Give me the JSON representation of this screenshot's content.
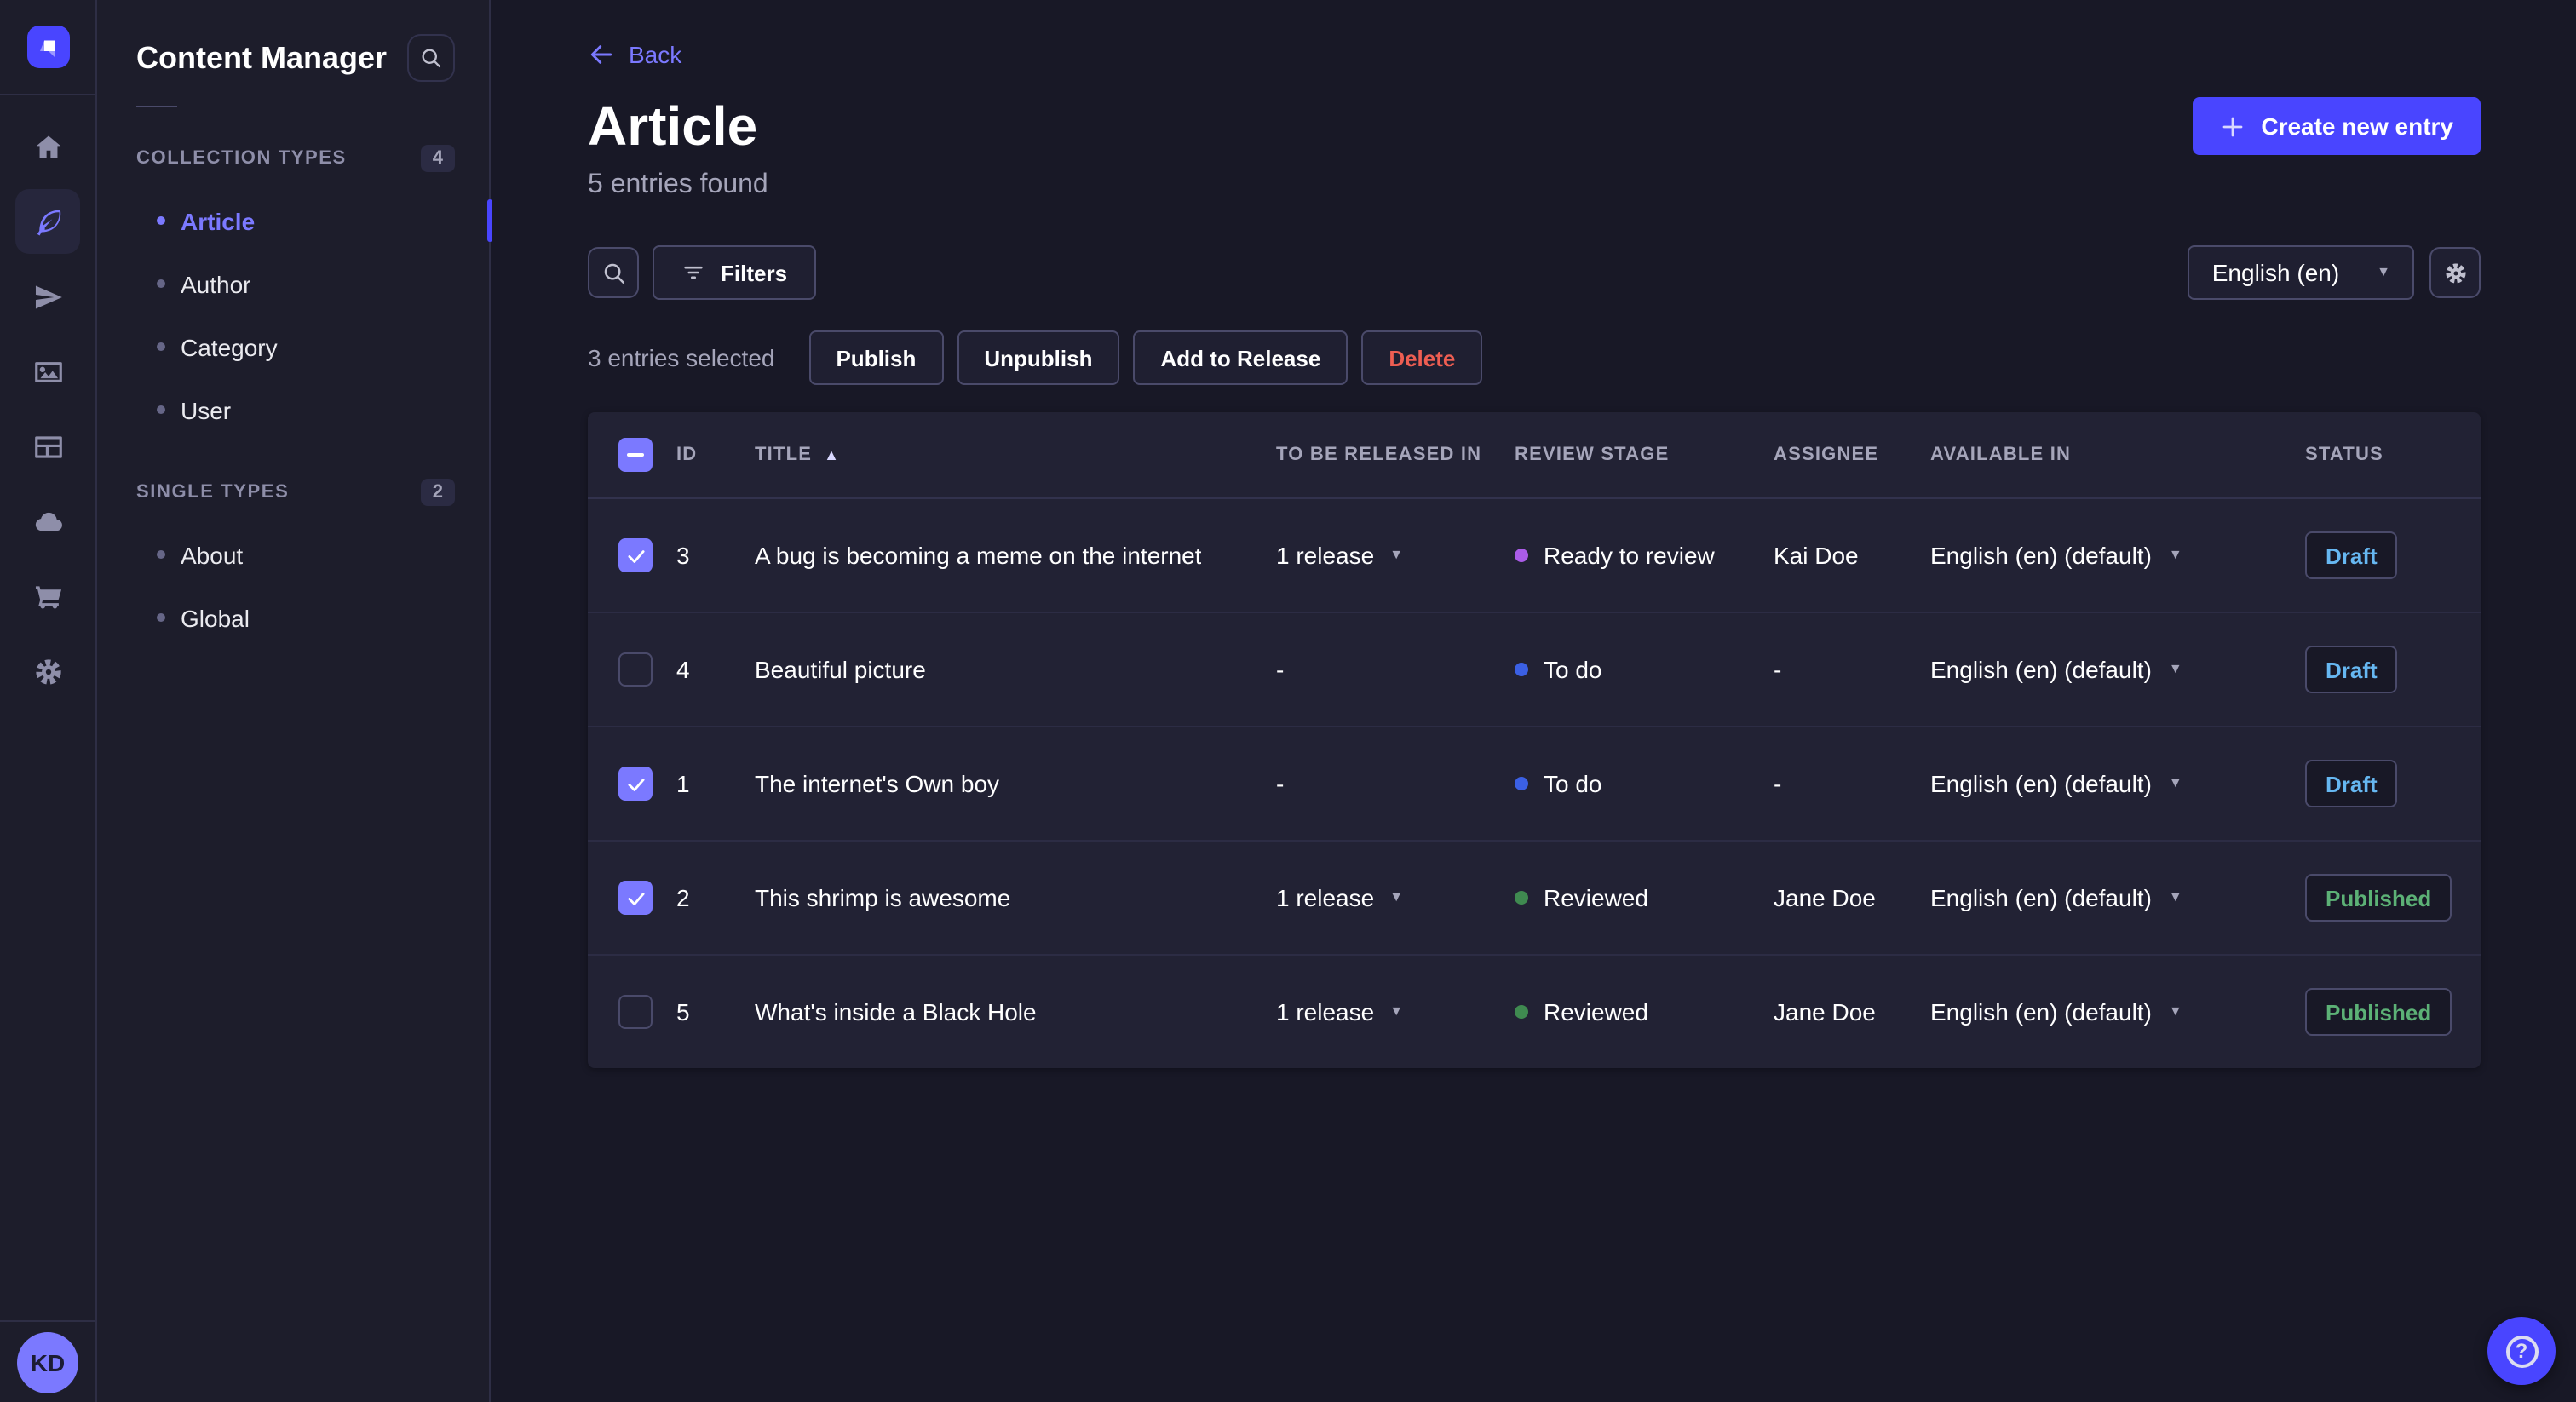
{
  "rail": {
    "logo_icon": "strapi-logo-icon",
    "icons": [
      "home-icon",
      "content-manager-feather-icon",
      "releases-plane-icon",
      "media-library-icon",
      "content-type-builder-icon",
      "cloud-icon",
      "marketplace-cart-icon",
      "settings-gear-icon"
    ],
    "active_icon_index": 1,
    "avatar_initials": "KD"
  },
  "subnav": {
    "title": "Content Manager",
    "search_icon": "search-icon",
    "sections": [
      {
        "label": "COLLECTION TYPES",
        "count": "4",
        "items": [
          {
            "label": "Article",
            "active": true
          },
          {
            "label": "Author",
            "active": false
          },
          {
            "label": "Category",
            "active": false
          },
          {
            "label": "User",
            "active": false
          }
        ]
      },
      {
        "label": "SINGLE TYPES",
        "count": "2",
        "items": [
          {
            "label": "About",
            "active": false
          },
          {
            "label": "Global",
            "active": false
          }
        ]
      }
    ]
  },
  "header": {
    "back_label": "Back",
    "title": "Article",
    "subtitle": "5 entries found",
    "create_label": "Create new entry"
  },
  "toolbar": {
    "search_icon": "search-icon",
    "filters_label": "Filters",
    "locale_value": "English (en)",
    "settings_icon": "gear-icon"
  },
  "selection": {
    "text": "3 entries selected",
    "actions": [
      {
        "label": "Publish",
        "danger": false
      },
      {
        "label": "Unpublish",
        "danger": false
      },
      {
        "label": "Add to Release",
        "danger": false
      },
      {
        "label": "Delete",
        "danger": true
      }
    ]
  },
  "table": {
    "columns": [
      "ID",
      "TITLE",
      "TO BE RELEASED IN",
      "REVIEW STAGE",
      "ASSIGNEE",
      "AVAILABLE IN",
      "STATUS"
    ],
    "sorted_column": "TITLE",
    "sort_direction": "asc",
    "header_checkbox_state": "indeterminate",
    "stage_colors": {
      "To do": "#3b60e4",
      "Ready to review": "#ab5ce8",
      "Reviewed": "#3f8a50"
    },
    "status_colors": {
      "Draft": "#66b7f1",
      "Published": "#5cb176"
    },
    "rows": [
      {
        "checked": true,
        "id": "3",
        "title": "A bug is becoming a meme on the internet",
        "release": "1 release",
        "stage": "Ready to review",
        "assignee": "Kai Doe",
        "available": "English (en) (default)",
        "status": "Draft"
      },
      {
        "checked": false,
        "id": "4",
        "title": "Beautiful picture",
        "release": "-",
        "stage": "To do",
        "assignee": "-",
        "available": "English (en) (default)",
        "status": "Draft"
      },
      {
        "checked": true,
        "id": "1",
        "title": "The internet's Own boy",
        "release": "-",
        "stage": "To do",
        "assignee": "-",
        "available": "English (en) (default)",
        "status": "Draft"
      },
      {
        "checked": true,
        "id": "2",
        "title": "This shrimp is awesome",
        "release": "1 release",
        "stage": "Reviewed",
        "assignee": "Jane Doe",
        "available": "English (en) (default)",
        "status": "Published"
      },
      {
        "checked": false,
        "id": "5",
        "title": "What's inside a Black Hole",
        "release": "1 release",
        "stage": "Reviewed",
        "assignee": "Jane Doe",
        "available": "English (en) (default)",
        "status": "Published"
      }
    ]
  },
  "help": {
    "label": "?",
    "icon": "help-question-icon"
  },
  "colors": {
    "accent": "#4945ff",
    "accent_light": "#7b79ff",
    "page_bg": "#181826",
    "panel_bg": "#1d1d2b",
    "card_bg": "#222234",
    "border": "#32324d",
    "muted_text": "#a5a5ba",
    "danger": "#ee5e52",
    "draft": "#66b7f1",
    "published": "#5cb176"
  }
}
